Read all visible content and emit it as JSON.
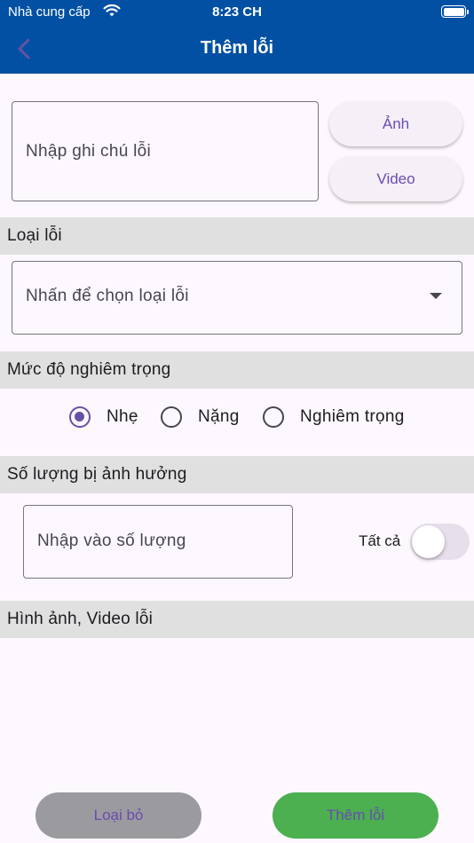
{
  "status_bar": {
    "carrier": "Nhà cung cấp",
    "time": "8:23 CH",
    "icons": [
      "wifi-icon",
      "battery-icon"
    ]
  },
  "app_bar": {
    "title": "Thêm lỗi",
    "back_icon": "chevron-left-icon",
    "back_icon_color": "#6750a4",
    "background": "#0250a3"
  },
  "note": {
    "placeholder": "Nhập ghi chú lỗi"
  },
  "media_buttons": {
    "photo": "Ảnh",
    "video": "Video"
  },
  "defect_type": {
    "section_label": "Loại lỗi",
    "placeholder": "Nhấn để chọn loại lỗi",
    "caret_icon": "caret-down-icon"
  },
  "severity": {
    "section_label": "Mức độ nghiêm trọng",
    "options": [
      "Nhẹ",
      "Nặng",
      "Nghiêm trọng"
    ],
    "selected": "Nhẹ",
    "accent": "#6750a4"
  },
  "quantity": {
    "section_label": "Số lượng bị ảnh hưởng",
    "placeholder": "Nhập vào số lượng",
    "all_label": "Tất cả",
    "all_enabled": false
  },
  "media": {
    "section_label": "Hình ảnh, Video lỗi"
  },
  "actions": {
    "remove": "Loại bỏ",
    "remove_color": "#9b9a9f",
    "add": "Thêm lỗi",
    "add_color": "#4caf50"
  }
}
